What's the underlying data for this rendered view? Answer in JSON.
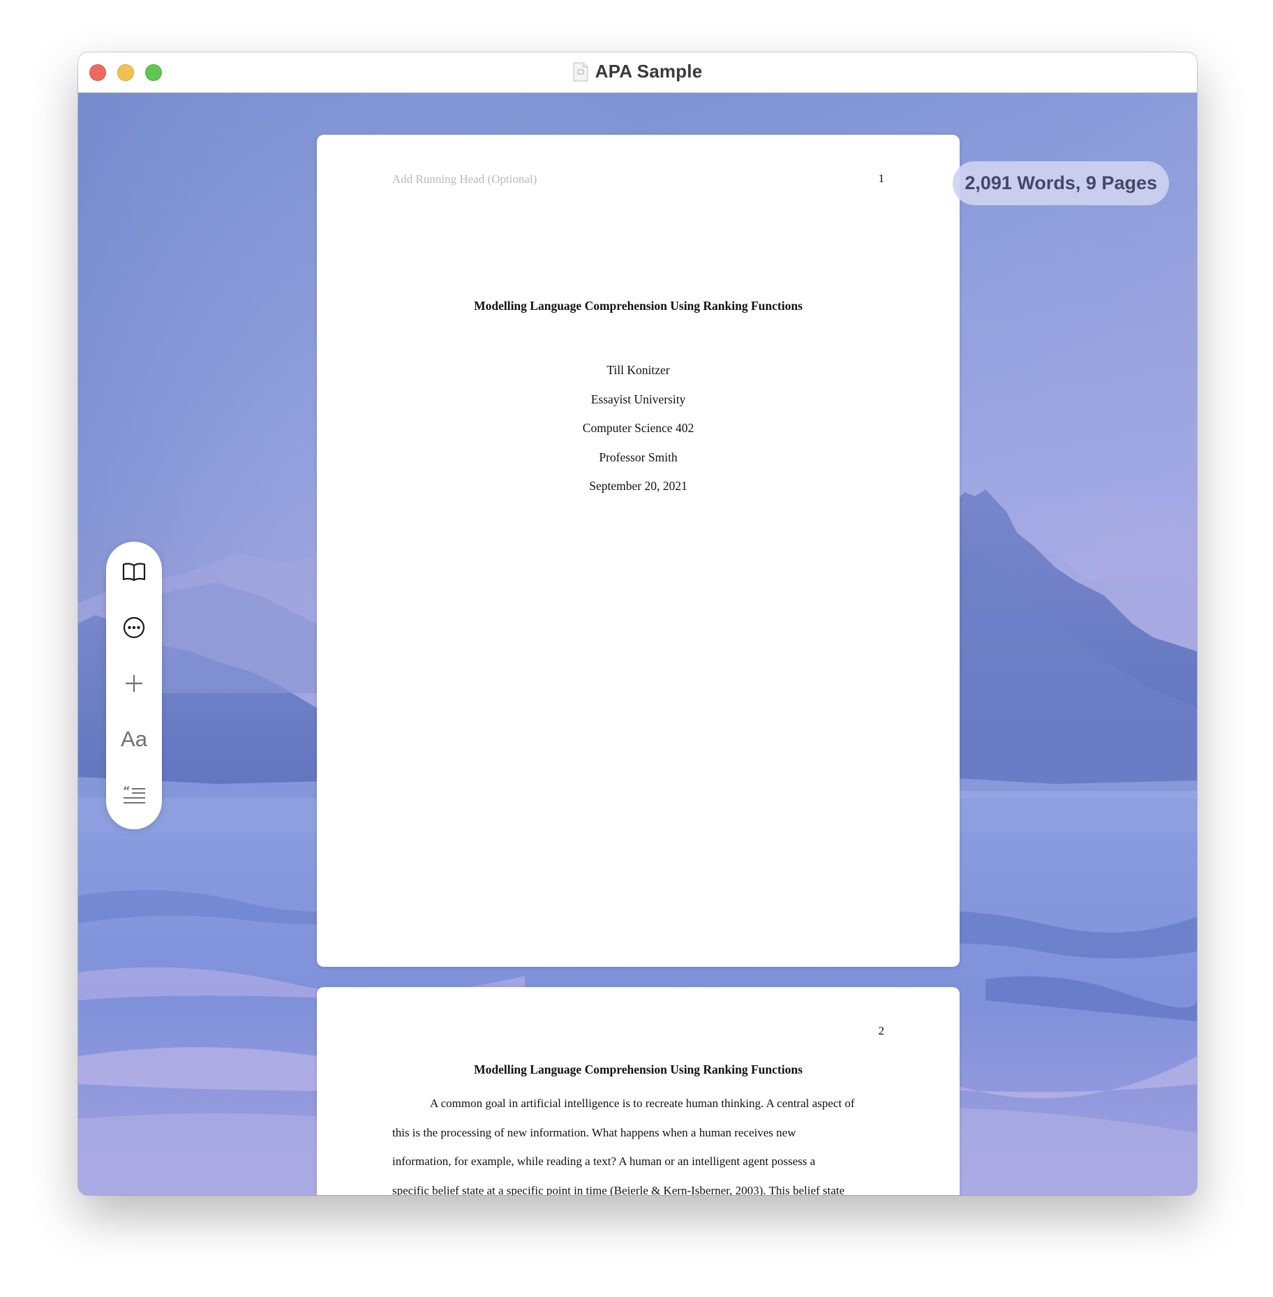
{
  "window": {
    "title": "APA Sample",
    "document_icon": "document-icon"
  },
  "traffic_lights": [
    "close",
    "minimize",
    "maximize"
  ],
  "status_badge": {
    "text": "2,091 Words, 9 Pages"
  },
  "toolbar": {
    "items": [
      {
        "name": "book-icon",
        "label": ""
      },
      {
        "name": "more-options-icon",
        "label": ""
      },
      {
        "name": "plus-icon",
        "label": ""
      },
      {
        "name": "font-format-icon",
        "label": "Aa"
      },
      {
        "name": "citation-icon",
        "label": ""
      }
    ]
  },
  "pages": [
    {
      "running_head_placeholder": "Add Running Head (Optional)",
      "page_number": "1",
      "title": "Modelling Language Comprehension Using Ranking Functions",
      "author": "Till Konitzer",
      "institution": "Essayist University",
      "course": "Computer Science 402",
      "instructor": "Professor Smith",
      "date": "September 20, 2021"
    },
    {
      "page_number": "2",
      "title": "Modelling Language Comprehension Using Ranking Functions",
      "body_lines": [
        "A common goal in artificial intelligence is to recreate human thinking. A central aspect of",
        "this is the processing of new information. What happens when a human receives new",
        "information, for example, while reading a text? A human or an intelligent agent possess a",
        "specific belief state at a specific point in time (Beierle & Kern-Isberner, 2003). This belief state"
      ]
    }
  ],
  "colors": {
    "sky_top": "#7e95d6",
    "sky_mid": "#9ea8e4",
    "sky_haze": "#b9b2e6",
    "mountain": "#6779c0",
    "water": "#7b8fd8",
    "badge_bg": "#ced2f0",
    "badge_text": "#454766"
  }
}
